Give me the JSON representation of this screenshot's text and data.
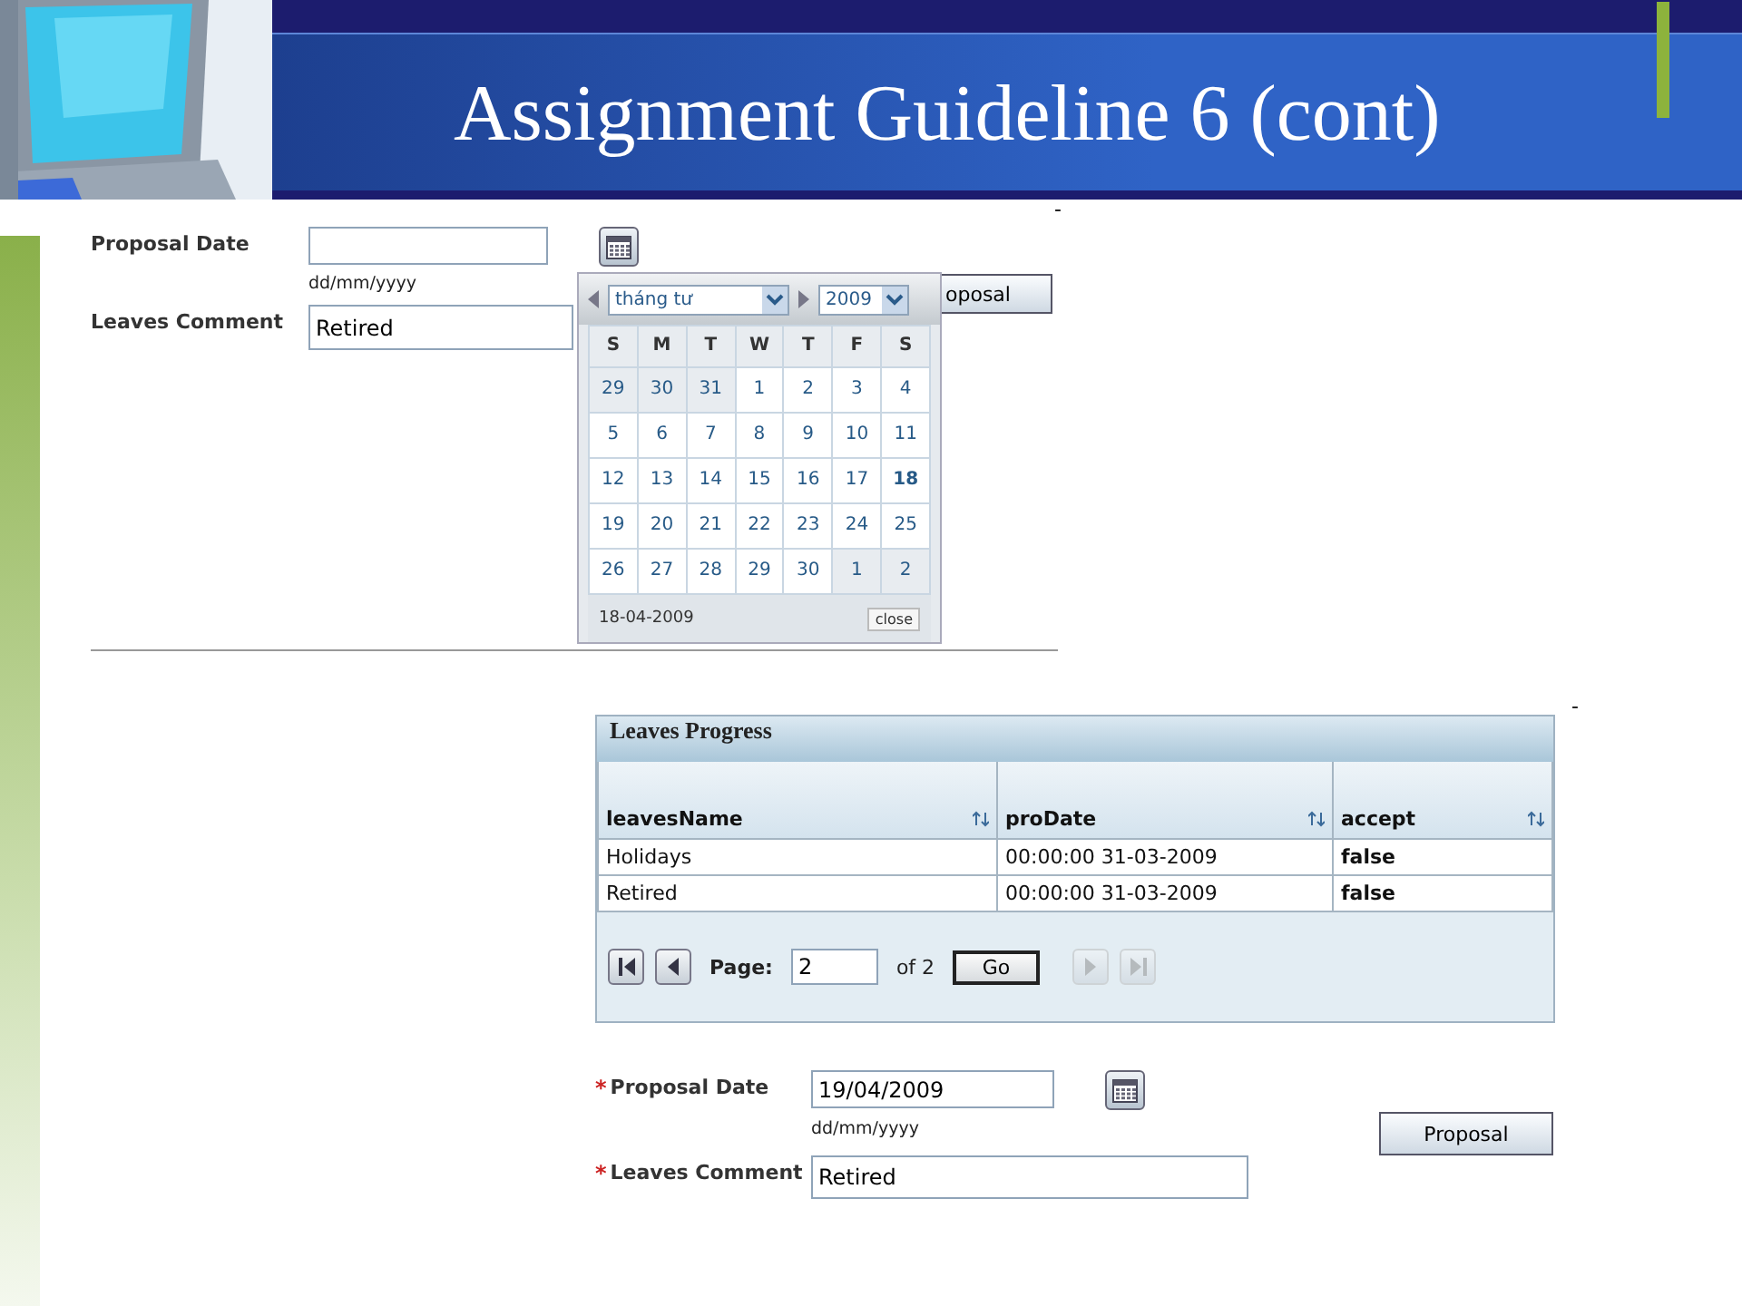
{
  "slide": {
    "title": "Assignment Guideline 6 (cont)"
  },
  "top_form": {
    "marks": [
      "-"
    ],
    "date_label": "Proposal Date",
    "date_hint": "dd/mm/yyyy",
    "comment_label": "Leaves Comment",
    "comment_value": "Retired",
    "button": "oposal"
  },
  "calendar": {
    "month": "tháng tư",
    "year": "2009",
    "weekdays": [
      "S",
      "M",
      "T",
      "W",
      "T",
      "F",
      "S"
    ],
    "weeks": [
      [
        {
          "text": "29",
          "other_month": true,
          "today": false
        },
        {
          "text": "30",
          "other_month": true,
          "today": false
        },
        {
          "text": "31",
          "other_month": true,
          "today": false
        },
        {
          "text": "1",
          "other_month": false,
          "today": false
        },
        {
          "text": "2",
          "other_month": false,
          "today": false
        },
        {
          "text": "3",
          "other_month": false,
          "today": false
        },
        {
          "text": "4",
          "other_month": false,
          "today": false
        }
      ],
      [
        {
          "text": "5",
          "other_month": false,
          "today": false
        },
        {
          "text": "6",
          "other_month": false,
          "today": false
        },
        {
          "text": "7",
          "other_month": false,
          "today": false
        },
        {
          "text": "8",
          "other_month": false,
          "today": false
        },
        {
          "text": "9",
          "other_month": false,
          "today": false
        },
        {
          "text": "10",
          "other_month": false,
          "today": false
        },
        {
          "text": "11",
          "other_month": false,
          "today": false
        }
      ],
      [
        {
          "text": "12",
          "other_month": false,
          "today": false
        },
        {
          "text": "13",
          "other_month": false,
          "today": false
        },
        {
          "text": "14",
          "other_month": false,
          "today": false
        },
        {
          "text": "15",
          "other_month": false,
          "today": false
        },
        {
          "text": "16",
          "other_month": false,
          "today": false
        },
        {
          "text": "17",
          "other_month": false,
          "today": false
        },
        {
          "text": "18",
          "other_month": false,
          "today": true
        }
      ],
      [
        {
          "text": "19",
          "other_month": false,
          "today": false
        },
        {
          "text": "20",
          "other_month": false,
          "today": false
        },
        {
          "text": "21",
          "other_month": false,
          "today": false
        },
        {
          "text": "22",
          "other_month": false,
          "today": false
        },
        {
          "text": "23",
          "other_month": false,
          "today": false
        },
        {
          "text": "24",
          "other_month": false,
          "today": false
        },
        {
          "text": "25",
          "other_month": false,
          "today": false
        }
      ],
      [
        {
          "text": "26",
          "other_month": false,
          "today": false
        },
        {
          "text": "27",
          "other_month": false,
          "today": false
        },
        {
          "text": "28",
          "other_month": false,
          "today": false
        },
        {
          "text": "29",
          "other_month": false,
          "today": false
        },
        {
          "text": "30",
          "other_month": false,
          "today": false
        },
        {
          "text": "1",
          "other_month": true,
          "today": false
        },
        {
          "text": "2",
          "other_month": true,
          "today": false
        }
      ]
    ],
    "footer_date": "18-04-2009",
    "close": "close"
  },
  "table": {
    "marks": [
      "-"
    ],
    "title": "Leaves Progress",
    "columns": [
      "leavesName",
      "proDate",
      "accept"
    ],
    "rows": [
      [
        "Holidays",
        "00:00:00 31-03-2009",
        "false"
      ],
      [
        "Retired",
        "00:00:00 31-03-2009",
        "false"
      ]
    ],
    "pager": {
      "label": "Page:",
      "value": "2",
      "of": "of 2",
      "go": "Go"
    }
  },
  "bottom_form": {
    "required_mark": "*",
    "date_label": "Proposal Date",
    "date_value": "19/04/2009",
    "date_hint": "dd/mm/yyyy",
    "comment_label": "Leaves Comment",
    "comment_value": "Retired",
    "button": "Proposal"
  }
}
